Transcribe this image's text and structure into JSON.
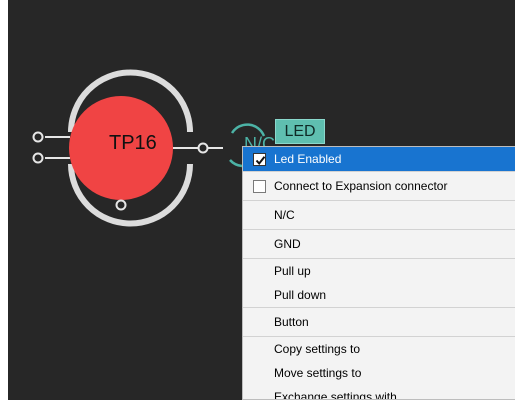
{
  "schematic": {
    "component_label": "TP16",
    "net_label": "N/C",
    "badge_label": "LED"
  },
  "context_menu": {
    "items": [
      {
        "label": "Led Enabled",
        "checked": true,
        "highlighted": true
      },
      {
        "label": "Connect to Expansion connector",
        "checked": false
      },
      {
        "label": "N/C"
      },
      {
        "label": "GND"
      },
      {
        "label": "Pull up"
      },
      {
        "label": "Pull down"
      },
      {
        "label": "Button"
      },
      {
        "label": "Copy settings to",
        "submenu": true
      },
      {
        "label": "Move settings to",
        "submenu": true
      },
      {
        "label": "Exchange settings with",
        "submenu": true
      }
    ]
  },
  "colors": {
    "canvas_bg": "#272727",
    "pin_fill": "#f04444",
    "net_accent": "#4cb3a6",
    "menu_highlight": "#1874d0"
  }
}
